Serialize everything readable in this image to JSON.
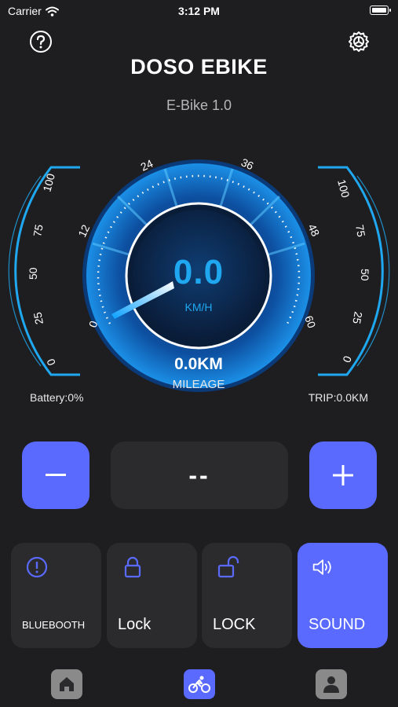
{
  "status": {
    "carrier": "Carrier",
    "time": "3:12 PM"
  },
  "header": {
    "title": "DOSO EBIKE",
    "subtitle": "E-Bike 1.0"
  },
  "gauge": {
    "speed": "0.0",
    "speed_unit": "KM/H",
    "mileage": "0.0KM",
    "mileage_label": "MILEAGE",
    "battery": "Battery:0%",
    "trip": "TRIP:0.0KM",
    "speed_ticks": [
      "0",
      "12",
      "24",
      "36",
      "48",
      "60"
    ],
    "left_scale": [
      "100",
      "75",
      "50",
      "25",
      "0"
    ],
    "right_scale": [
      "100",
      "75",
      "50",
      "25",
      "0"
    ],
    "current_speed_kmh": 0
  },
  "controls": {
    "minus": "−",
    "level": "--",
    "plus": "+"
  },
  "tiles": [
    {
      "label": "BLUEBOOTH",
      "icon": "alert-circle-icon"
    },
    {
      "label": "Lock",
      "icon": "lock-closed-icon"
    },
    {
      "label": "LOCK",
      "icon": "lock-open-icon"
    },
    {
      "label": "SOUND",
      "icon": "speaker-icon"
    }
  ],
  "tabbar": {
    "items": [
      "home-icon",
      "bicycle-icon",
      "person-icon"
    ]
  },
  "colors": {
    "accent": "#5a6aff",
    "gauge_blue": "#1fa8f0",
    "background": "#1e1e20",
    "tile_bg": "#2b2b2e"
  }
}
